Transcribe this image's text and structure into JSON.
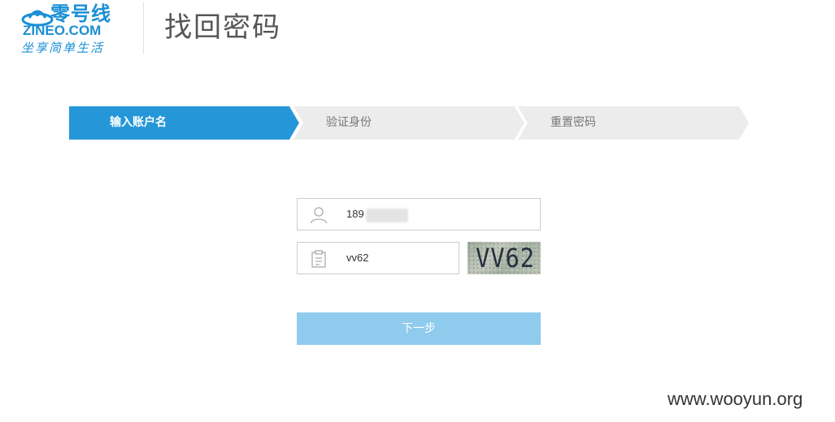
{
  "logo": {
    "brand_cn": "零号线",
    "brand_en": "ZINEO.COM",
    "slogan": "坐享简单生活",
    "color": "#1a8fd6"
  },
  "page_title": "找回密码",
  "steps": {
    "items": [
      {
        "label": "输入账户名",
        "active": true
      },
      {
        "label": "验证身份",
        "active": false
      },
      {
        "label": "重置密码",
        "active": false
      }
    ],
    "active_color": "#2597d8",
    "inactive_color": "#ececec"
  },
  "form": {
    "account": {
      "value": "189",
      "icon": "user-icon"
    },
    "captcha": {
      "value": "vv62",
      "icon": "clipboard-icon"
    },
    "captcha_image_text": "VV62",
    "next_label": "下一步",
    "button_color": "#8fcbec"
  },
  "watermark": "www.wooyun.org"
}
